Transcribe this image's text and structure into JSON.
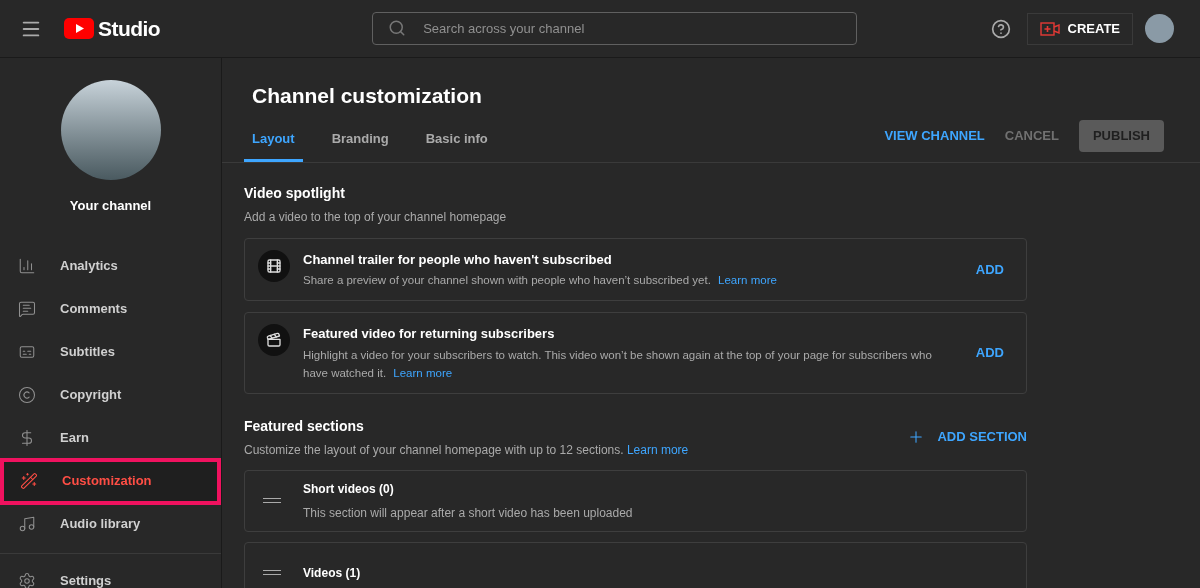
{
  "header": {
    "logo_text": "Studio",
    "search": {
      "placeholder": "Search across your channel"
    },
    "create_button": "CREATE"
  },
  "sidebar": {
    "channel_label": "Your channel",
    "items": [
      {
        "label": "Analytics",
        "kind": "analytics",
        "selected": false
      },
      {
        "label": "Comments",
        "kind": "comments",
        "selected": false
      },
      {
        "label": "Subtitles",
        "kind": "subtitles",
        "selected": false
      },
      {
        "label": "Copyright",
        "kind": "copyright",
        "selected": false
      },
      {
        "label": "Earn",
        "kind": "earn",
        "selected": false
      },
      {
        "label": "Customization",
        "kind": "customization",
        "selected": true
      },
      {
        "label": "Audio library",
        "kind": "audio",
        "selected": false
      }
    ],
    "footer_items": [
      {
        "label": "Settings",
        "kind": "settings",
        "selected": false
      }
    ]
  },
  "page": {
    "title": "Channel customization",
    "tabs": [
      {
        "label": "Layout",
        "selected": true
      },
      {
        "label": "Branding",
        "selected": false
      },
      {
        "label": "Basic info",
        "selected": false
      }
    ],
    "actions": {
      "view_channel": "VIEW CHANNEL",
      "cancel": "CANCEL",
      "publish": "PUBLISH"
    },
    "video_spotlight": {
      "title": "Video spotlight",
      "subtitle": "Add a video to the top of your channel homepage",
      "cards": [
        {
          "kind": "trailer",
          "title": "Channel trailer for people who haven't subscribed",
          "text": "Share a preview of your channel shown with people who haven’t subscribed yet.",
          "link": "Learn more",
          "action": "ADD"
        },
        {
          "kind": "featured",
          "title": "Featured video for returning subscribers",
          "text": "Highlight a video for your subscribers to watch. This video won’t be shown again at the top of your page for subscribers who have watched it.",
          "link": "Learn more",
          "action": "ADD"
        }
      ]
    },
    "featured_sections": {
      "title": "Featured sections",
      "subtitle": "Customize the layout of your channel homepage with up to 12 sections.",
      "link": "Learn more",
      "add_button": "ADD SECTION",
      "sections": [
        {
          "title": "Short videos (0)",
          "text": "This section will appear after a short video has been uploaded"
        },
        {
          "title": "Videos (1)"
        }
      ]
    }
  }
}
